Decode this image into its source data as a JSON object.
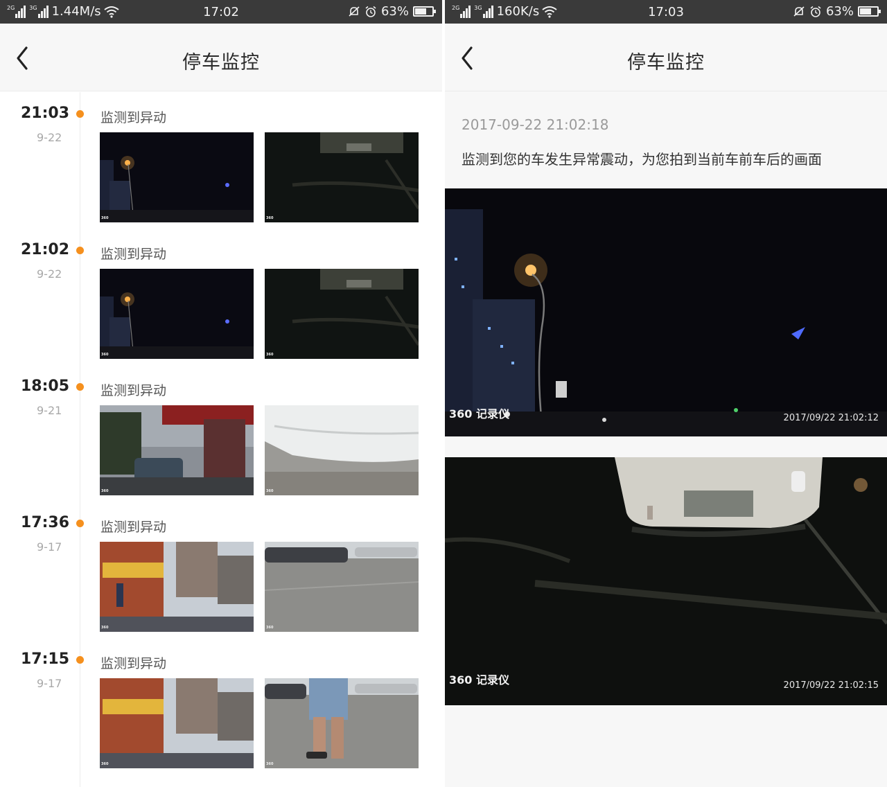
{
  "left_screen": {
    "status": {
      "network_speed": "1.44M/s",
      "time": "17:02",
      "battery": "63%",
      "battery_level": 0.63
    },
    "title": "停车监控",
    "events": [
      {
        "time": "21:03",
        "date": "9-22",
        "label": "监测到异动"
      },
      {
        "time": "21:02",
        "date": "9-22",
        "label": "监测到异动"
      },
      {
        "time": "18:05",
        "date": "9-21",
        "label": "监测到异动"
      },
      {
        "time": "17:36",
        "date": "9-17",
        "label": "监测到异动"
      },
      {
        "time": "17:15",
        "date": "9-17",
        "label": "监测到异动"
      }
    ]
  },
  "right_screen": {
    "status": {
      "network_speed": "160K/s",
      "time": "17:03",
      "battery": "63%",
      "battery_level": 0.63
    },
    "title": "停车监控",
    "timestamp": "2017-09-22 21:02:18",
    "message": "监测到您的车发生异常震动，为您拍到当前车前车后的画面",
    "photos": [
      {
        "watermark_logo": "360 记录仪",
        "watermark_time": "2017/09/22 21:02:12"
      },
      {
        "watermark_logo": "360 记录仪",
        "watermark_time": "2017/09/22 21:02:15"
      }
    ]
  },
  "colors": {
    "accent": "#f5901e",
    "status_bar": "#3a3a3a",
    "nav_bg": "#f7f7f7"
  }
}
